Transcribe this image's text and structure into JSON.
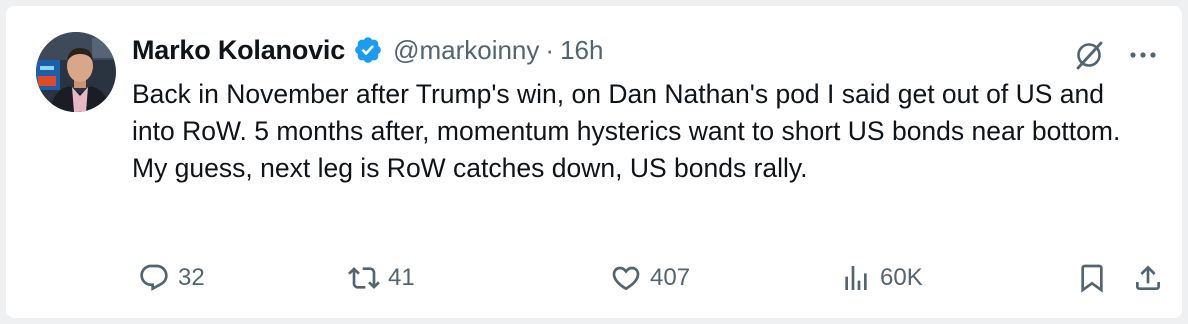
{
  "tweet": {
    "author_name": "Marko Kolanovic",
    "handle": "@markoinny",
    "separator": "·",
    "time": "16h",
    "text": "Back in November after Trump's win, on Dan Nathan's pod I said get out of US and into RoW. 5 months after, momentum hysterics want to short US bonds near bottom. My guess, next leg is RoW catches down, US bonds rally."
  },
  "icons": {
    "verified": "verified-badge-icon",
    "grok": "grok-icon",
    "more": "more-options-icon",
    "reply": "reply-icon",
    "retweet": "retweet-icon",
    "like": "like-icon",
    "views": "views-icon",
    "bookmark": "bookmark-icon",
    "share": "share-icon"
  },
  "stats": {
    "replies": "32",
    "retweets": "41",
    "likes": "407",
    "views": "60K"
  },
  "colors": {
    "verified": "#1d9bf0",
    "text": "#0f1419",
    "secondary": "#536471",
    "background": "#ffffff"
  }
}
